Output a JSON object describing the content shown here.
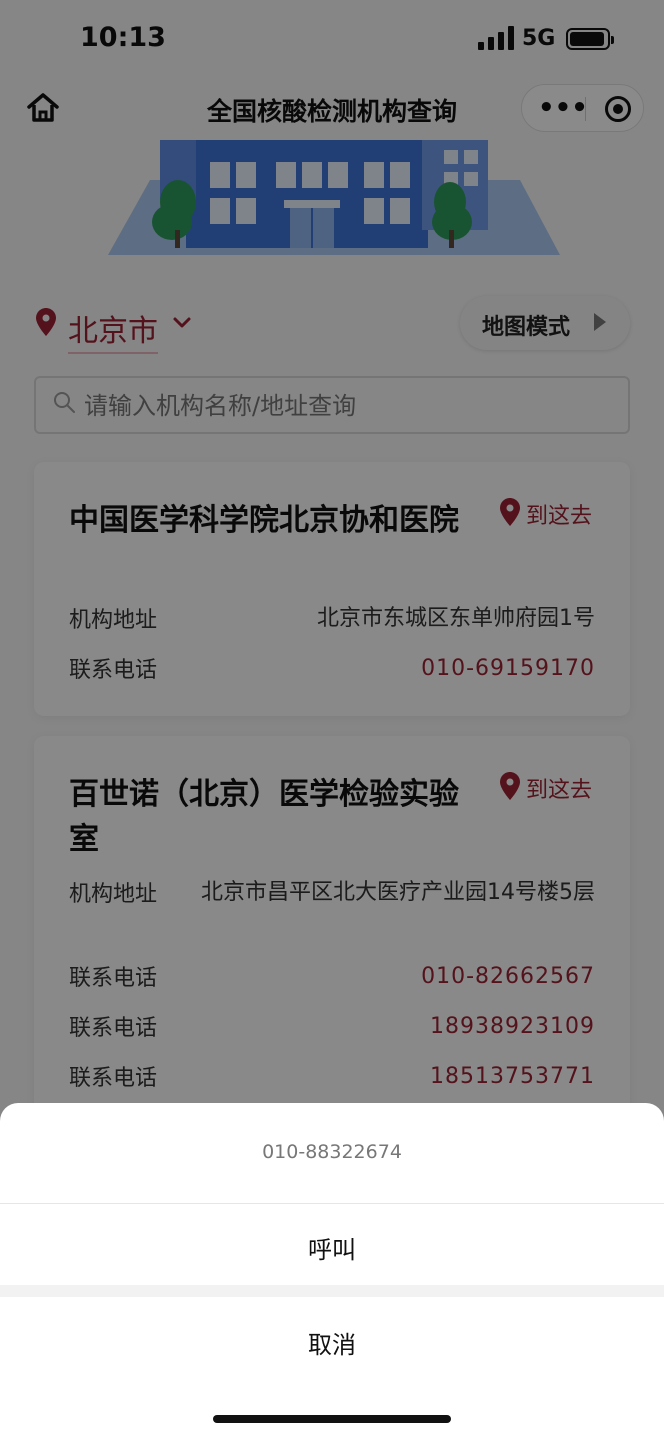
{
  "status_bar": {
    "time": "10:13",
    "network": "5G"
  },
  "nav": {
    "title": "全国核酸检测机构查询"
  },
  "location": {
    "city": "北京市",
    "map_mode_label": "地图模式"
  },
  "search": {
    "placeholder": "请输入机构名称/地址查询"
  },
  "colors": {
    "accent": "#9a2434",
    "banner_blue": "#3f73d6"
  },
  "institutions": [
    {
      "name": "中国医学科学院北京协和医院",
      "go_label": "到这去",
      "address_label": "机构地址",
      "address": "北京市东城区东单帅府园1号",
      "phones": [
        {
          "label": "联系电话",
          "number": "010-69159170"
        }
      ]
    },
    {
      "name": "百世诺（北京）医学检验实验室",
      "go_label": "到这去",
      "address_label": "机构地址",
      "address": "北京市昌平区北大医疗产业园14号楼5层",
      "phones": [
        {
          "label": "联系电话",
          "number": "010-82662567"
        },
        {
          "label": "联系电话",
          "number": "18938923109"
        },
        {
          "label": "联系电话",
          "number": "18513753771"
        }
      ]
    }
  ],
  "action_sheet": {
    "title": "010-88322674",
    "call_label": "呼叫",
    "cancel_label": "取消"
  }
}
